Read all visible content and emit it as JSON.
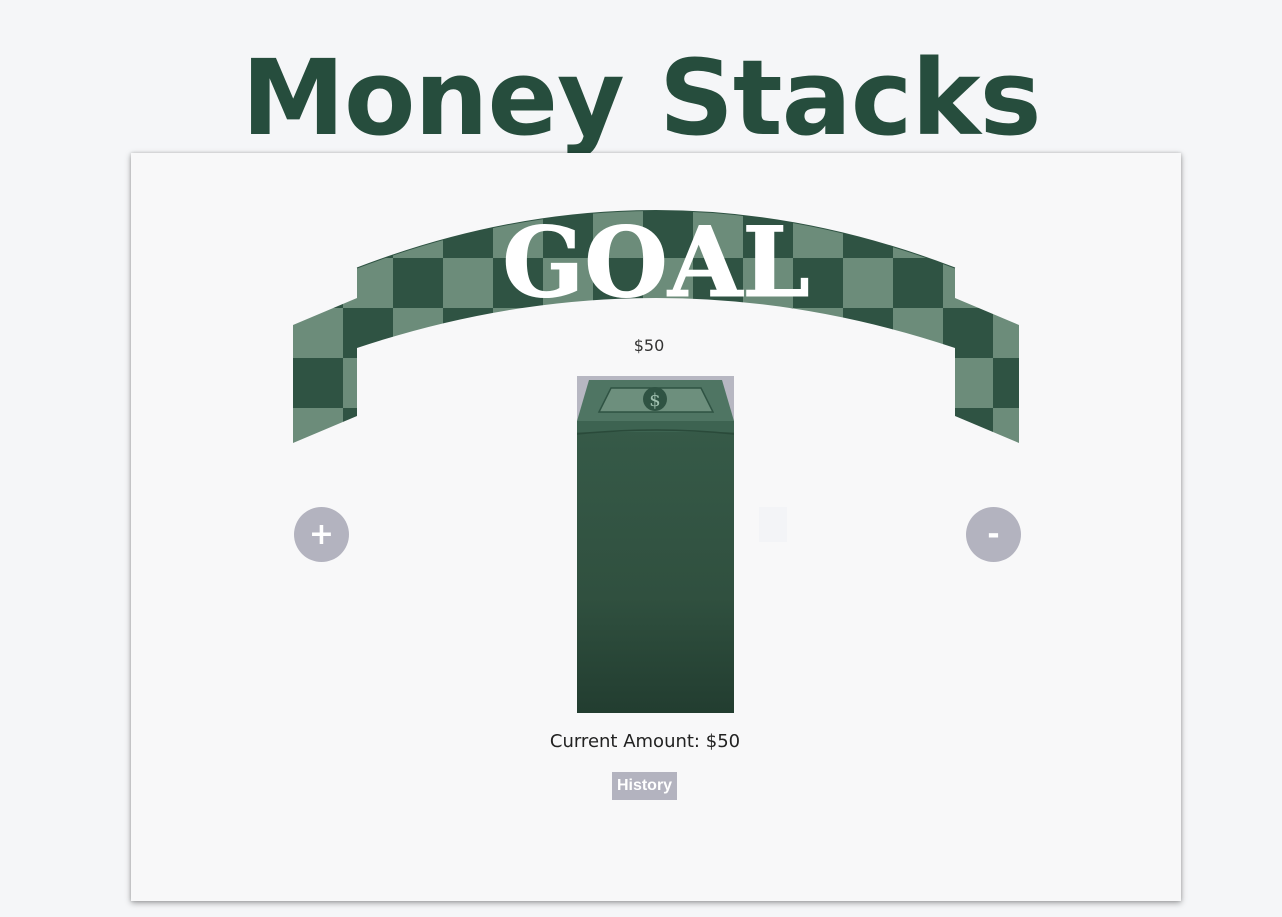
{
  "app": {
    "title": "Money Stacks"
  },
  "goal": {
    "banner_text": "GOAL",
    "amount": "$50"
  },
  "stack": {
    "dollar_symbol": "$"
  },
  "controls": {
    "plus_label": "+",
    "minus_label": "-"
  },
  "current": {
    "label": "Current Amount:",
    "amount": "$50"
  },
  "history": {
    "label": "History"
  },
  "colors": {
    "brand_green": "#264d3d",
    "banner_dark": "#2f5343",
    "banner_light": "#6c8c7a",
    "button_gray": "#b3b3bf",
    "card_bg": "#f8f8f9",
    "page_bg": "#f5f6f8"
  }
}
